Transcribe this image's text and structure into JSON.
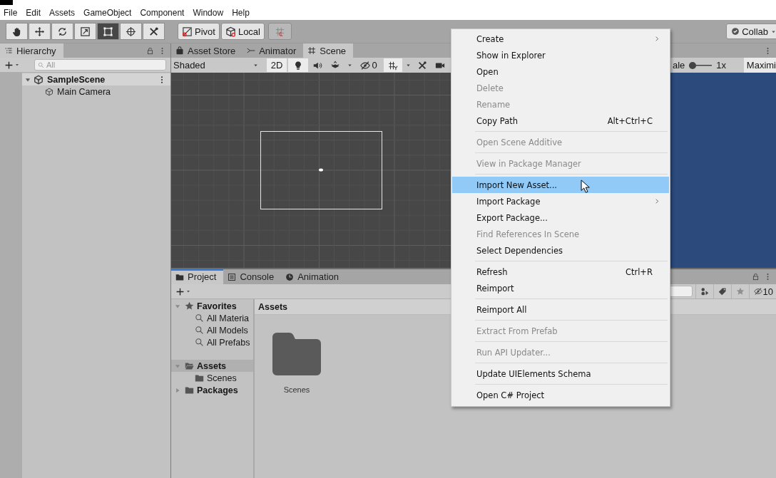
{
  "menu_bar": [
    "File",
    "Edit",
    "Assets",
    "GameObject",
    "Component",
    "Window",
    "Help"
  ],
  "toolbar": {
    "tools": [
      {
        "kind": "hand",
        "selected": false
      },
      {
        "kind": "move",
        "selected": false
      },
      {
        "kind": "rotate",
        "selected": false
      },
      {
        "kind": "scale",
        "selected": false
      },
      {
        "kind": "rect",
        "selected": true
      },
      {
        "kind": "transform",
        "selected": false
      },
      {
        "kind": "custom",
        "selected": false
      }
    ],
    "pivot": "Pivot",
    "local": "Local",
    "snap": {
      "disabled": true
    },
    "collab": "Collab"
  },
  "hierarchy": {
    "title": "Hierarchy",
    "search_placeholder": "All",
    "tree": [
      {
        "label": "SampleScene",
        "kind": "scene",
        "expanded": true,
        "children": [
          {
            "label": "Main Camera",
            "kind": "object"
          }
        ]
      }
    ]
  },
  "scene_tabs": [
    {
      "label": "Asset Store",
      "kind": "store",
      "selected": false
    },
    {
      "label": "Animator",
      "kind": "animator",
      "selected": false
    },
    {
      "label": "Scene",
      "kind": "scene",
      "selected": true
    }
  ],
  "scene_toolbar": {
    "shading": "Shaded",
    "mode_2d": "2D",
    "hidden_count": "0"
  },
  "game_toolbar": {
    "scale_label": "ale",
    "scale": {
      "level": 0
    },
    "scale_value": "1x",
    "maximize": "Maximi"
  },
  "project": {
    "tabs": [
      {
        "label": "Project",
        "kind": "project",
        "selected": true
      },
      {
        "label": "Console",
        "kind": "console",
        "selected": false
      },
      {
        "label": "Animation",
        "kind": "animation",
        "selected": false
      }
    ],
    "hidden_count": "10",
    "sidebar": [
      {
        "label": "Favorites",
        "kind": "favorites",
        "expanded": true,
        "selected": false,
        "children": [
          {
            "label": "All Materia",
            "kind": "search",
            "selected": false
          },
          {
            "label": "All Models",
            "kind": "search",
            "selected": false
          },
          {
            "label": "All Prefabs",
            "kind": "search",
            "selected": false
          }
        ]
      },
      {
        "label": "Assets",
        "kind": "folder",
        "expanded": true,
        "selected": true,
        "children": [
          {
            "label": "Scenes",
            "kind": "folder",
            "selected": false
          }
        ]
      },
      {
        "label": "Packages",
        "kind": "folder",
        "expanded": false,
        "selected": false
      }
    ],
    "breadcrumb": "Assets",
    "items": [
      {
        "label": "Scenes",
        "kind": "folder"
      }
    ]
  },
  "context_menu": [
    {
      "kind": "item",
      "label": "Create",
      "submenu": true,
      "disabled": false,
      "highlighted": false
    },
    {
      "kind": "item",
      "label": "Show in Explorer",
      "submenu": false,
      "disabled": false,
      "highlighted": false
    },
    {
      "kind": "item",
      "label": "Open",
      "submenu": false,
      "disabled": false,
      "highlighted": false
    },
    {
      "kind": "item",
      "label": "Delete",
      "submenu": false,
      "disabled": true,
      "highlighted": false
    },
    {
      "kind": "item",
      "label": "Rename",
      "submenu": false,
      "disabled": true,
      "highlighted": false
    },
    {
      "kind": "item",
      "label": "Copy Path",
      "shortcut": "Alt+Ctrl+C",
      "submenu": false,
      "disabled": false,
      "highlighted": false
    },
    {
      "kind": "separator"
    },
    {
      "kind": "item",
      "label": "Open Scene Additive",
      "submenu": false,
      "disabled": true,
      "highlighted": false
    },
    {
      "kind": "separator"
    },
    {
      "kind": "item",
      "label": "View in Package Manager",
      "submenu": false,
      "disabled": true,
      "highlighted": false
    },
    {
      "kind": "separator"
    },
    {
      "kind": "item",
      "label": "Import New Asset...",
      "submenu": false,
      "disabled": false,
      "highlighted": true
    },
    {
      "kind": "item",
      "label": "Import Package",
      "submenu": true,
      "disabled": false,
      "highlighted": false
    },
    {
      "kind": "item",
      "label": "Export Package...",
      "submenu": false,
      "disabled": false,
      "highlighted": false
    },
    {
      "kind": "item",
      "label": "Find References In Scene",
      "submenu": false,
      "disabled": true,
      "highlighted": false
    },
    {
      "kind": "item",
      "label": "Select Dependencies",
      "submenu": false,
      "disabled": false,
      "highlighted": false
    },
    {
      "kind": "separator"
    },
    {
      "kind": "item",
      "label": "Refresh",
      "shortcut": "Ctrl+R",
      "submenu": false,
      "disabled": false,
      "highlighted": false
    },
    {
      "kind": "item",
      "label": "Reimport",
      "submenu": false,
      "disabled": false,
      "highlighted": false
    },
    {
      "kind": "separator"
    },
    {
      "kind": "item",
      "label": "Reimport All",
      "submenu": false,
      "disabled": false,
      "highlighted": false
    },
    {
      "kind": "separator"
    },
    {
      "kind": "item",
      "label": "Extract From Prefab",
      "submenu": false,
      "disabled": true,
      "highlighted": false
    },
    {
      "kind": "separator"
    },
    {
      "kind": "item",
      "label": "Run API Updater...",
      "submenu": false,
      "disabled": true,
      "highlighted": false
    },
    {
      "kind": "separator"
    },
    {
      "kind": "item",
      "label": "Update UIElements Schema",
      "submenu": false,
      "disabled": false,
      "highlighted": false
    },
    {
      "kind": "separator"
    },
    {
      "kind": "item",
      "label": "Open C# Project",
      "submenu": false,
      "disabled": false,
      "highlighted": false
    }
  ]
}
